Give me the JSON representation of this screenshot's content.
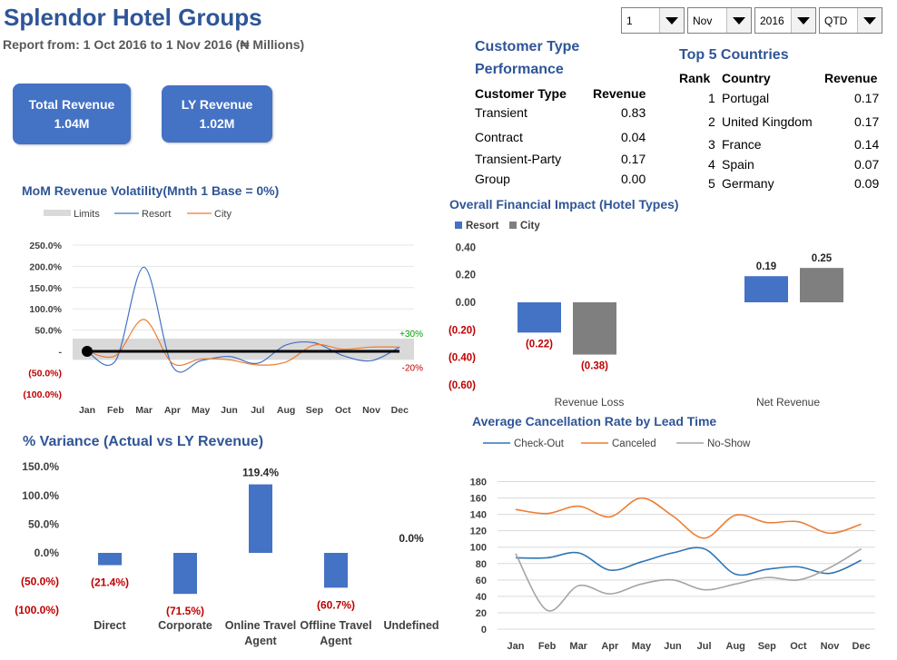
{
  "header": {
    "title": "Splendor Hotel Groups",
    "subtitle": "Report from: 1 Oct 2016 to 1 Nov 2016 (₦ Millions)"
  },
  "filters": [
    {
      "name": "day",
      "value": "1"
    },
    {
      "name": "month",
      "value": "Nov"
    },
    {
      "name": "year",
      "value": "2016"
    },
    {
      "name": "period",
      "value": "QTD"
    }
  ],
  "kpis": {
    "total_revenue": {
      "label": "Total Revenue",
      "value": "1.04M"
    },
    "ly_revenue": {
      "label": "LY Revenue",
      "value": "1.02M"
    }
  },
  "customer_type": {
    "title_line1": "Customer Type",
    "title_line2": "Performance",
    "col1": "Customer Type",
    "col2": "Revenue",
    "rows": [
      {
        "type": "Transient",
        "revenue": "0.83"
      },
      {
        "type": "Contract",
        "revenue": "0.04"
      },
      {
        "type": "Transient-Party",
        "revenue": "0.17"
      },
      {
        "type": "Group",
        "revenue": "0.00"
      }
    ]
  },
  "top_countries": {
    "title": "Top 5 Countries",
    "col_rank": "Rank",
    "col_country": "Country",
    "col_revenue": "Revenue",
    "rows": [
      {
        "rank": "1",
        "country": "Portugal",
        "revenue": "0.17"
      },
      {
        "rank": "2",
        "country": "United Kingdom",
        "revenue": "0.17"
      },
      {
        "rank": "3",
        "country": "France",
        "revenue": "0.14"
      },
      {
        "rank": "4",
        "country": "Spain",
        "revenue": "0.07"
      },
      {
        "rank": "5",
        "country": "Germany",
        "revenue": "0.09"
      }
    ]
  },
  "chart_data": [
    {
      "id": "mom",
      "type": "line",
      "title": "MoM Revenue Volatility(Mnth 1 Base = 0%)",
      "legend": [
        "Limits",
        "Resort",
        "City"
      ],
      "colors": {
        "limits": "#d9d9d9",
        "resort": "#4472c4",
        "city": "#ed7d31",
        "base": "#000000"
      },
      "categories": [
        "Jan",
        "Feb",
        "Mar",
        "Apr",
        "May",
        "Jun",
        "Jul",
        "Aug",
        "Sep",
        "Oct",
        "Nov",
        "Dec"
      ],
      "y_ticks": [
        250,
        200,
        150,
        100,
        50,
        0,
        -50,
        -100
      ],
      "y_tick_labels": [
        "250.0%",
        "200.0%",
        "150.0%",
        "100.0%",
        "50.0%",
        "-",
        "(50.0%)",
        "(100.0%)"
      ],
      "ylim": [
        -100,
        250
      ],
      "limits": [
        -20,
        30
      ],
      "limit_labels": {
        "upper": "+30%",
        "lower": "-20%"
      },
      "series": [
        {
          "name": "Resort",
          "values": [
            0,
            -22,
            198,
            -35,
            -22,
            -12,
            -28,
            15,
            20,
            -10,
            -22,
            10
          ]
        },
        {
          "name": "City",
          "values": [
            0,
            -10,
            75,
            -28,
            -18,
            -20,
            -32,
            -25,
            15,
            5,
            10,
            10
          ]
        }
      ],
      "base_value": 0
    },
    {
      "id": "impact",
      "type": "bar",
      "title": "Overall Financial Impact (Hotel Types)",
      "legend": [
        "Resort",
        "City"
      ],
      "colors": {
        "resort": "#4472c4",
        "city": "#7f7f7f"
      },
      "categories": [
        "Revenue Loss",
        "Net Revenue"
      ],
      "series": [
        {
          "name": "Resort",
          "values": [
            -0.22,
            0.19
          ],
          "labels": [
            "(0.22)",
            "0.19"
          ]
        },
        {
          "name": "City",
          "values": [
            -0.38,
            0.25
          ],
          "labels": [
            "(0.38)",
            "0.25"
          ]
        }
      ],
      "y_ticks": [
        0.4,
        0.2,
        0,
        -0.2,
        -0.4,
        -0.6
      ],
      "y_tick_labels": [
        "0.40",
        "0.20",
        "0.00",
        "(0.20)",
        "(0.40)",
        "(0.60)"
      ],
      "ylim": [
        -0.6,
        0.4
      ]
    },
    {
      "id": "variance",
      "type": "bar",
      "title": "% Variance (Actual vs LY Revenue)",
      "categories": [
        "Direct",
        "Corporate",
        "Online Travel Agent",
        "Offline Travel Agent",
        "Undefined"
      ],
      "category_lines": [
        [
          "Direct"
        ],
        [
          "Corporate"
        ],
        [
          "Online Travel",
          "Agent"
        ],
        [
          "Offline Travel",
          "Agent"
        ],
        [
          "Undefined"
        ]
      ],
      "values": [
        -21.4,
        -71.5,
        119.4,
        -60.7,
        0.0
      ],
      "labels": [
        "(21.4%)",
        "(71.5%)",
        "119.4%",
        "(60.7%)",
        "0.0%"
      ],
      "color": "#4472c4",
      "y_ticks": [
        150,
        100,
        50,
        0,
        -50,
        -100
      ],
      "y_tick_labels": [
        "150.0%",
        "100.0%",
        "50.0%",
        "0.0%",
        "(50.0%)",
        "(100.0%)"
      ],
      "ylim": [
        -100,
        150
      ]
    },
    {
      "id": "cancel",
      "type": "line",
      "title": "Average Cancellation Rate by Lead Time",
      "legend": [
        "Check-Out",
        "Canceled",
        "No-Show"
      ],
      "colors": {
        "checkout": "#2e75b6",
        "canceled": "#ed7d31",
        "noshow": "#a5a5a5"
      },
      "categories": [
        "Jan",
        "Feb",
        "Mar",
        "Apr",
        "May",
        "Jun",
        "Jul",
        "Aug",
        "Sep",
        "Oct",
        "Nov",
        "Dec"
      ],
      "y_ticks": [
        180,
        160,
        140,
        120,
        100,
        80,
        60,
        40,
        20,
        0
      ],
      "ylim": [
        0,
        180
      ],
      "series": [
        {
          "name": "Check-Out",
          "values": [
            87,
            87,
            93,
            72,
            82,
            93,
            98,
            67,
            73,
            76,
            68,
            84
          ]
        },
        {
          "name": "Canceled",
          "values": [
            146,
            141,
            150,
            137,
            160,
            138,
            111,
            139,
            130,
            131,
            117,
            128
          ]
        },
        {
          "name": "No-Show",
          "values": [
            92,
            23,
            53,
            43,
            55,
            60,
            48,
            55,
            63,
            60,
            75,
            98
          ]
        }
      ]
    }
  ]
}
